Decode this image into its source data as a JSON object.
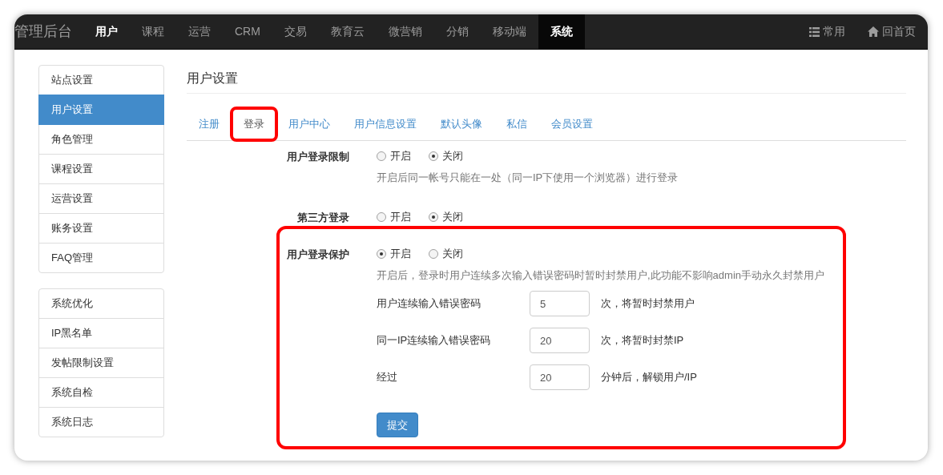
{
  "navbar": {
    "brand": "管理后台",
    "items": [
      {
        "label": "用户",
        "selected": false,
        "emphasized": true
      },
      {
        "label": "课程",
        "selected": false,
        "emphasized": false
      },
      {
        "label": "运营",
        "selected": false,
        "emphasized": false
      },
      {
        "label": "CRM",
        "selected": false,
        "emphasized": false
      },
      {
        "label": "交易",
        "selected": false,
        "emphasized": false
      },
      {
        "label": "教育云",
        "selected": false,
        "emphasized": false
      },
      {
        "label": "微营销",
        "selected": false,
        "emphasized": false
      },
      {
        "label": "分销",
        "selected": false,
        "emphasized": false
      },
      {
        "label": "移动端",
        "selected": false,
        "emphasized": false
      },
      {
        "label": "系统",
        "selected": true,
        "emphasized": true
      }
    ],
    "right_links": [
      {
        "kind": "list",
        "label": "常用"
      },
      {
        "kind": "home",
        "label": "回首页"
      }
    ]
  },
  "sidebar": {
    "groups": [
      [
        {
          "label": "站点设置",
          "selected": false
        },
        {
          "label": "用户设置",
          "selected": true
        },
        {
          "label": "角色管理",
          "selected": false
        },
        {
          "label": "课程设置",
          "selected": false
        },
        {
          "label": "运营设置",
          "selected": false
        },
        {
          "label": "账务设置",
          "selected": false
        },
        {
          "label": "FAQ管理",
          "selected": false
        }
      ],
      [
        {
          "label": "系统优化",
          "selected": false
        },
        {
          "label": "IP黑名单",
          "selected": false
        },
        {
          "label": "发帖限制设置",
          "selected": false
        },
        {
          "label": "系统自检",
          "selected": false
        },
        {
          "label": "系统日志",
          "selected": false
        }
      ]
    ]
  },
  "page_title": "用户设置",
  "tabs": [
    {
      "label": "注册",
      "selected": false,
      "highlighted": false
    },
    {
      "label": "登录",
      "selected": true,
      "highlighted": true
    },
    {
      "label": "用户中心",
      "selected": false,
      "highlighted": false
    },
    {
      "label": "用户信息设置",
      "selected": false,
      "highlighted": false
    },
    {
      "label": "默认头像",
      "selected": false,
      "highlighted": false
    },
    {
      "label": "私信",
      "selected": false,
      "highlighted": false
    },
    {
      "label": "会员设置",
      "selected": false,
      "highlighted": false
    }
  ],
  "sections": [
    {
      "label": "用户登录限制",
      "highlighted": false,
      "options": [
        {
          "label": "开启",
          "selected": false
        },
        {
          "label": "关闭",
          "selected": true
        }
      ],
      "hint": "开启后同一帐号只能在一处（同一IP下使用一个浏览器）进行登录"
    },
    {
      "label": "第三方登录",
      "highlighted": false,
      "options": [
        {
          "label": "开启",
          "selected": false
        },
        {
          "label": "关闭",
          "selected": true
        }
      ]
    },
    {
      "label": "用户登录保护",
      "highlighted": true,
      "options": [
        {
          "label": "开启",
          "selected": true
        },
        {
          "label": "关闭",
          "selected": false
        }
      ],
      "hint": "开启后，登录时用户连续多次输入错误密码时暂时封禁用户,此功能不影响admin手动永久封禁用户",
      "fields": [
        {
          "label": "用户连续输入错误密码",
          "value": "5",
          "suffix": "次，将暂时封禁用户"
        },
        {
          "label": "同一IP连续输入错误密码",
          "value": "20",
          "suffix": "次，将暂时封禁IP"
        },
        {
          "label": "经过",
          "value": "20",
          "suffix": "分钟后，解锁用户/IP"
        }
      ],
      "submit_button": "提交"
    }
  ]
}
